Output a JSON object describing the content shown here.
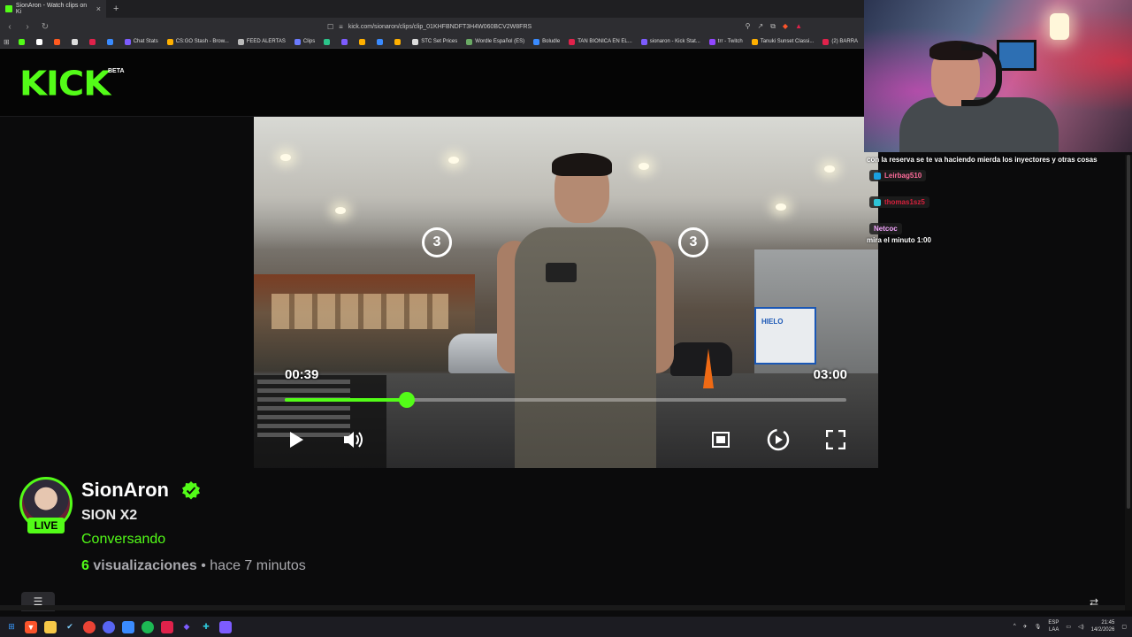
{
  "browser": {
    "tab_title": "SionAron - Watch clips on Ki",
    "tab_close": "×",
    "new_tab": "+",
    "url": "kick.com/sionaron/clips/clip_01KHFBNDFT3H4W060BCV2W8FRS",
    "bookmarks": [
      {
        "label": "",
        "color": "#53fc18"
      },
      {
        "label": "",
        "color": "#ffffff"
      },
      {
        "label": "",
        "color": "#ff5a1f"
      },
      {
        "label": "",
        "color": "#dddddd"
      },
      {
        "label": "",
        "color": "#e0224b"
      },
      {
        "label": "",
        "color": "#3a8bff"
      },
      {
        "label": "Chat Stats",
        "color": "#7d5cff"
      },
      {
        "label": "CS:GO Stash - Brow...",
        "color": "#ffb000"
      },
      {
        "label": "FEED ALERTAS",
        "color": "#bbbbbb"
      },
      {
        "label": "Clips",
        "color": "#6b7bff"
      },
      {
        "label": "",
        "color": "#2bc48a"
      },
      {
        "label": "",
        "color": "#7d5cff"
      },
      {
        "label": "",
        "color": "#ffb000"
      },
      {
        "label": "",
        "color": "#3a8bff"
      },
      {
        "label": "",
        "color": "#ffb000"
      },
      {
        "label": "STC Set Prices",
        "color": "#dddddd"
      },
      {
        "label": "Wordle Español (ES)",
        "color": "#6aaa64"
      },
      {
        "label": "Boludle",
        "color": "#3a8bff"
      },
      {
        "label": "TAN BIONICA EN EL...",
        "color": "#e0224b"
      },
      {
        "label": "sionaron - Kick Stat...",
        "color": "#7d5cff"
      },
      {
        "label": "trr - Twitch",
        "color": "#9146ff"
      },
      {
        "label": "Tanuki Sunset Classi...",
        "color": "#ffb000"
      },
      {
        "label": "(2) BARRA",
        "color": "#e0224b"
      }
    ]
  },
  "site": {
    "logo": "KICK",
    "beta": "BETA"
  },
  "player": {
    "skip_back": "3",
    "skip_forward": "3",
    "current_time": "00:39",
    "duration": "03:00",
    "progress": 0.2167
  },
  "channel": {
    "name": "SionAron",
    "live_badge": "LIVE",
    "stream_title": "SION X2",
    "category": "Conversando",
    "views_count": "6",
    "views_label": "visualizaciones",
    "separator": "•",
    "time_ago": "hace 7 minutos"
  },
  "chat_overlay": {
    "message_1": "con la reserva se te va haciendo mierda los inyectores y otras cosas",
    "user_1": "Leirbag510",
    "user_2": "thomas1sz5",
    "user_3": "Netcoc",
    "message_2": "mira el minuto 1:00"
  },
  "taskbar": {
    "lang": "ESP",
    "lang_sub": "LAA",
    "time": "21:45",
    "date": "14/2/2026"
  }
}
